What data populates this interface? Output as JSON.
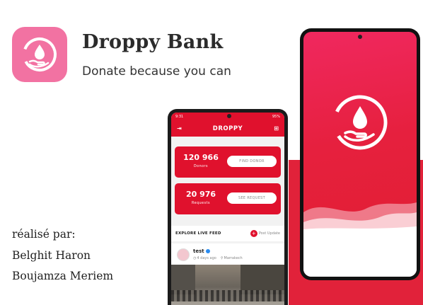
{
  "app": {
    "title": "Droppy Bank",
    "tagline": "Donate because you can",
    "brand_pink": "#f272a2",
    "brand_red": "#e0112d"
  },
  "credits": {
    "label": "réalisé par:",
    "authors": [
      "Belghit Haron",
      "Boujamza Meriem"
    ]
  },
  "phone_small": {
    "status_time": "9:31",
    "status_right": "95%",
    "appbar_title": "DROPPY",
    "donors": {
      "count": "120 966",
      "label": "Donors",
      "button": "FIND DONOR"
    },
    "requests": {
      "count": "20 976",
      "label": "Requests",
      "button": "SEE REQUEST"
    },
    "feed": {
      "title": "EXPLORE LIVE FEED",
      "post_button": "Post Update"
    },
    "post": {
      "user": "test",
      "time": "4 days ago",
      "location": "Marrakech"
    }
  },
  "phone_large": {
    "icons": [
      "blood-drop-hand-logo"
    ]
  }
}
